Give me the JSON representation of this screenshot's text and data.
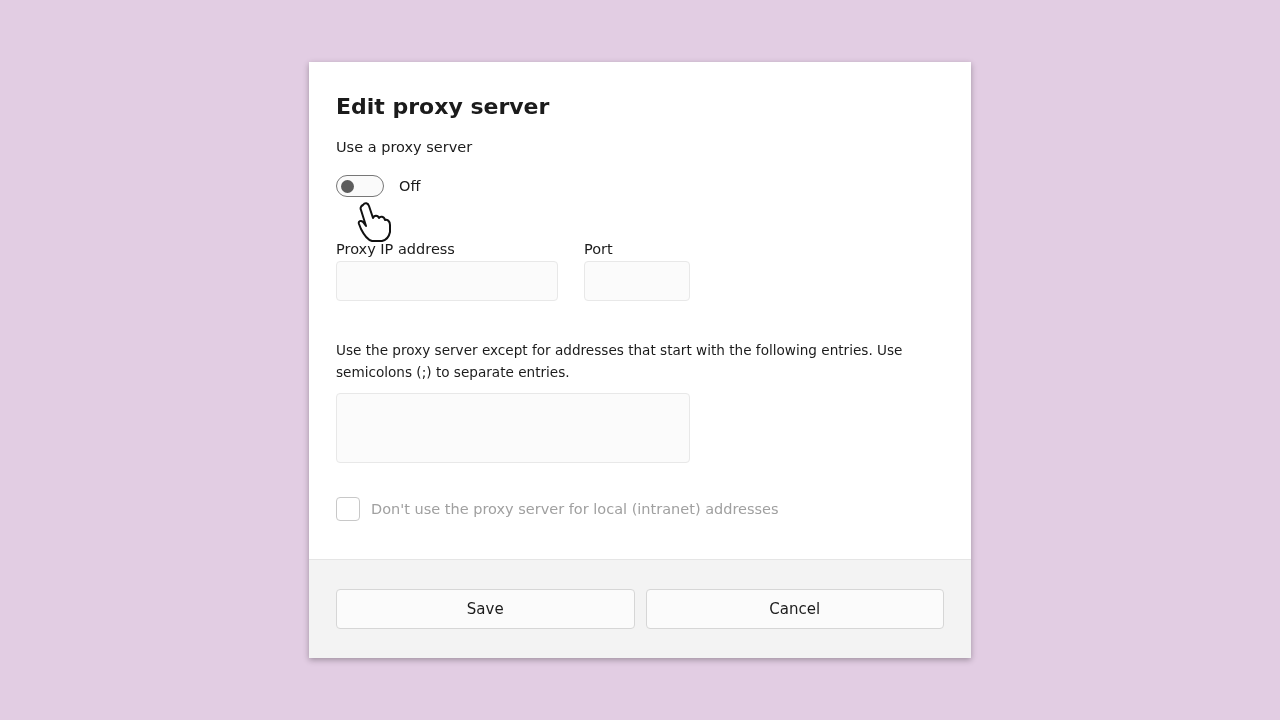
{
  "dialog": {
    "title": "Edit proxy server",
    "proxy_switch": {
      "label": "Use a proxy server",
      "on": false,
      "state_text": "Off"
    },
    "address_field": {
      "label": "Proxy IP address"
    },
    "port_field": {
      "label": "Port"
    },
    "exceptions": {
      "label": "Use the proxy server except for addresses that start with the following entries. Use semicolons (;) to separate entries."
    },
    "local_checkbox": {
      "label": "Don't use the proxy server for local (intranet) addresses",
      "checked": false,
      "disabled": true
    },
    "buttons": [
      {
        "label": "Save"
      },
      {
        "label": "Cancel"
      }
    ]
  }
}
